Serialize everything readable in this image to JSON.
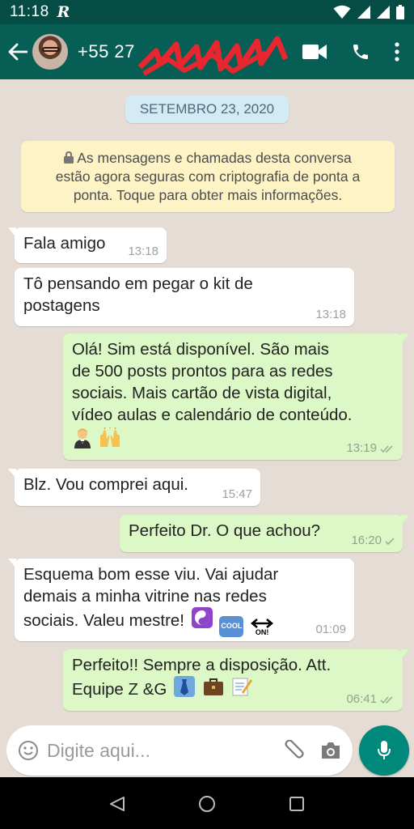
{
  "status_bar": {
    "time": "11:18",
    "app_indicator": "R"
  },
  "app_bar": {
    "contact": "+55 27 ",
    "icons": [
      "back-arrow-icon",
      "video-call-icon",
      "phone-icon",
      "more-vert-icon"
    ]
  },
  "chat": {
    "date": "SETEMBRO 23, 2020",
    "encryption_line1": "As mensagens e chamadas desta conversa",
    "encryption_line2": "estão agora seguras com criptografia de ponta a",
    "encryption_line3": "ponta. Toque para obter mais informações.",
    "messages": [
      {
        "dir": "in",
        "line1": "Fala amigo",
        "line2": "",
        "line3": "",
        "line4": "",
        "time": "13:18"
      },
      {
        "dir": "in",
        "line1": "Tô pensando em pegar o kit de",
        "line2": "postagens",
        "line3": "",
        "line4": "",
        "time": "13:18"
      },
      {
        "dir": "out",
        "line1": "Olá! Sim está disponível. São mais",
        "line2": "de 500 posts prontos para as redes",
        "line3": "sociais. Mais cartão de vista digital,",
        "line4": "vídeo aulas e calendário de conteúdo.",
        "time": "13:19",
        "status": "read"
      },
      {
        "dir": "in",
        "line1": "Blz. Vou comprei aqui.",
        "line2": "",
        "line3": "",
        "line4": "",
        "time": "15:47"
      },
      {
        "dir": "out",
        "line1": "Perfeito Dr. O que achou?",
        "line2": "",
        "line3": "",
        "line4": "",
        "time": "16:20",
        "status": "sent"
      },
      {
        "dir": "in",
        "line1": "Esquema bom esse viu. Vai ajudar",
        "line2": "demais a minha vitrine nas redes",
        "line3": "sociais. Valeu mestre!",
        "line4": "",
        "time": "01:09"
      },
      {
        "dir": "out",
        "line1": "Perfeito!! Sempre a disposição. Att.",
        "line2": "Equipe Z &G",
        "line3": "",
        "line4": "",
        "time": "06:41",
        "status": "read"
      }
    ],
    "emoji_labels": {
      "cool": "COOL",
      "on": "ON!"
    }
  },
  "composer": {
    "placeholder": "Digite aqui..."
  },
  "colors": {
    "header": "#075e54",
    "status_bar": "#054d44",
    "chat_bg": "#e5ddd5",
    "outgoing": "#dcf8c6",
    "incoming": "#ffffff",
    "accent": "#00897b"
  }
}
